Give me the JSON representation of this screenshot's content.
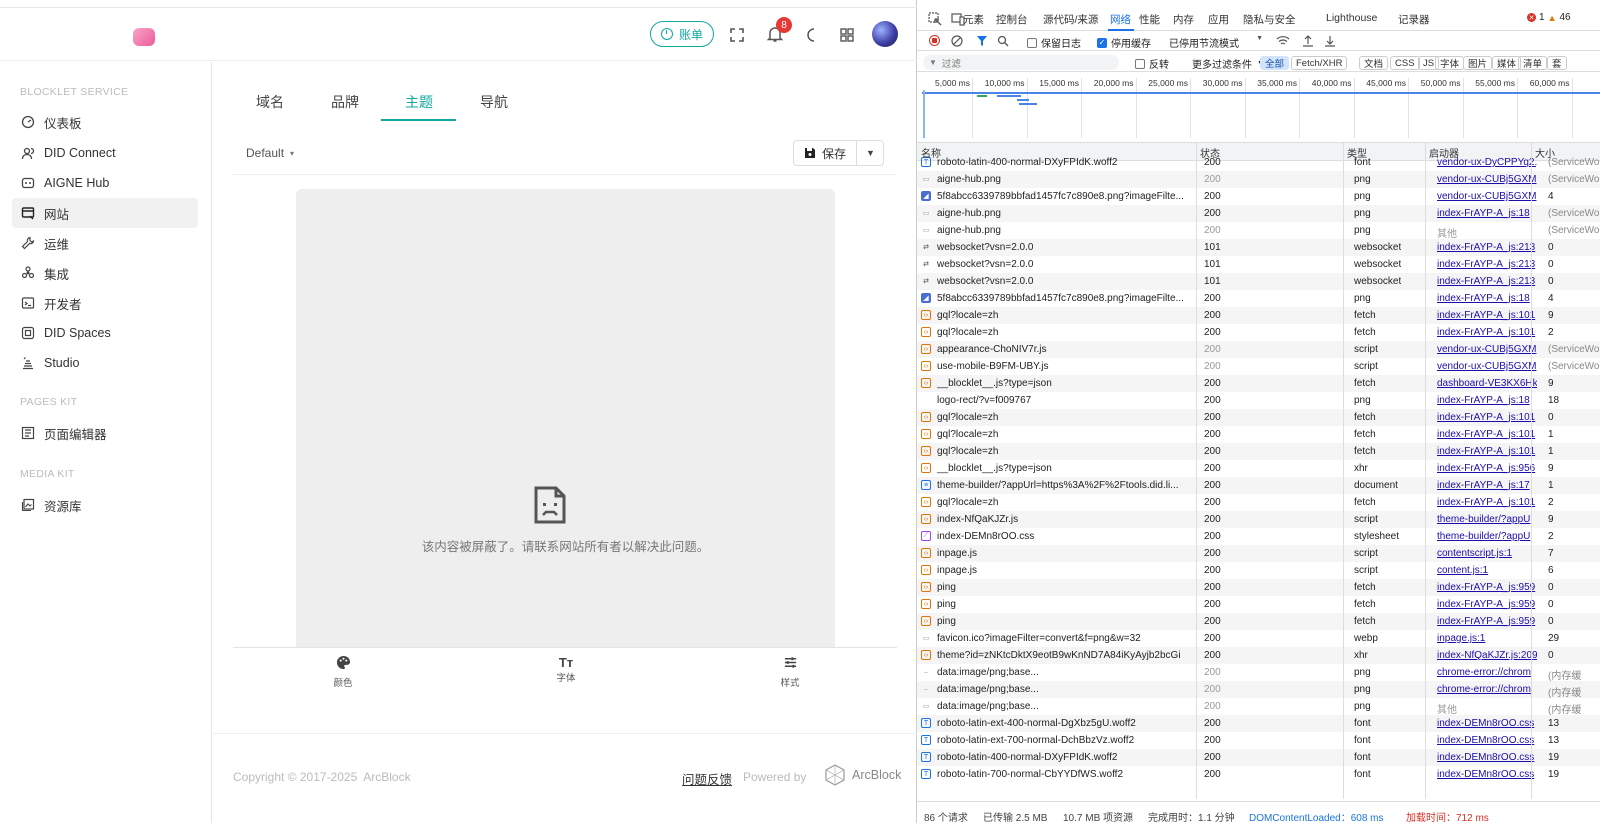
{
  "app": {
    "topbar": {
      "bill_label": "账单",
      "notification_count": "8"
    },
    "sidebar": {
      "sections": [
        {
          "title": "BLOCKLET SERVICE"
        },
        {
          "title": "PAGES KIT"
        },
        {
          "title": "MEDIA KIT"
        }
      ],
      "items": [
        {
          "label": "仪表板",
          "icon": "dashboard-icon"
        },
        {
          "label": "DID Connect",
          "icon": "users-icon"
        },
        {
          "label": "AIGNE Hub",
          "icon": "hub-icon"
        },
        {
          "label": "网站",
          "icon": "website-icon"
        },
        {
          "label": "运维",
          "icon": "wrench-icon"
        },
        {
          "label": "集成",
          "icon": "integration-icon"
        },
        {
          "label": "开发者",
          "icon": "terminal-icon"
        },
        {
          "label": "DID Spaces",
          "icon": "spaces-icon"
        },
        {
          "label": "Studio",
          "icon": "studio-icon"
        },
        {
          "label": "页面编辑器",
          "icon": "page-editor-icon"
        },
        {
          "label": "资源库",
          "icon": "media-library-icon"
        }
      ]
    },
    "tabs": [
      {
        "label": "域名"
      },
      {
        "label": "品牌"
      },
      {
        "label": "主题"
      },
      {
        "label": "导航"
      }
    ],
    "active_tab": "主题",
    "theme_select": "Default",
    "save_label": "保存",
    "blocked_message": "该内容被屏蔽了。请联系网站所有者以解决此问题。",
    "bottom_tools": [
      {
        "label": "颜色"
      },
      {
        "label": "字体"
      },
      {
        "label": "样式"
      }
    ],
    "footer": {
      "copyright": "Copyright © 2017-2025  ArcBlock",
      "feedback": "问题反馈",
      "powered_by": "Powered by",
      "brand": "ArcBlock"
    },
    "colors": {
      "accent": "#10a9a0",
      "badge": "#e53935"
    }
  },
  "devtools": {
    "tabs": [
      "元素",
      "控制台",
      "源代码/来源",
      "网络",
      "性能",
      "内存",
      "应用",
      "隐私与安全",
      "Lighthouse",
      "记录器"
    ],
    "active_tab": "网络",
    "errors": "1",
    "warnings": "46",
    "toolbar": {
      "preserve_log": "保留日志",
      "disable_cache": "停用缓存",
      "throttle": "已停用节流模式"
    },
    "filter": {
      "placeholder": "过滤",
      "invert": "反转",
      "more_filters": "更多过滤条件",
      "types": [
        "全部",
        "Fetch/XHR",
        "文档",
        "CSS",
        "JS",
        "字体",
        "图片",
        "媒体",
        "清单",
        "套"
      ]
    },
    "timeline_ticks": [
      "5,000 ms",
      "10,000 ms",
      "15,000 ms",
      "20,000 ms",
      "25,000 ms",
      "30,000 ms",
      "35,000 ms",
      "40,000 ms",
      "45,000 ms",
      "50,000 ms",
      "55,000 ms",
      "60,000 ms"
    ],
    "columns": [
      "名称",
      "状态",
      "类型",
      "启动器",
      "大小"
    ],
    "rows": [
      {
        "name": "roboto-latin-400-normal-DXyFPIdK.woff2",
        "status": "200",
        "type": "font",
        "initiator": "vendor-ux-DyCPPYq2.js",
        "size": "(ServiceWo",
        "kind": "font",
        "dim": false
      },
      {
        "name": "aigne-hub.png",
        "status": "200",
        "type": "png",
        "initiator": "vendor-ux-CUBj5GXM",
        "size": "(ServiceWo",
        "kind": "img",
        "dim": true
      },
      {
        "name": "5f8abcc6339789bbfad1457fc7c890e8.png?imageFilte...",
        "status": "200",
        "type": "png",
        "initiator": "vendor-ux-CUBj5GXM",
        "size": "4",
        "kind": "img2",
        "dim": false
      },
      {
        "name": "aigne-hub.png",
        "status": "200",
        "type": "png",
        "initiator": "index-FrAYP-A_js:18",
        "size": "(ServiceWo",
        "kind": "img",
        "dim": false
      },
      {
        "name": "aigne-hub.png",
        "status": "200",
        "type": "png",
        "initiator": "其他",
        "size": "(ServiceWo",
        "kind": "img",
        "dim": true,
        "plain": true
      },
      {
        "name": "websocket?vsn=2.0.0",
        "status": "101",
        "type": "websocket",
        "initiator": "index-FrAYP-A_js:213",
        "size": "0",
        "kind": "ws",
        "dim": false
      },
      {
        "name": "websocket?vsn=2.0.0",
        "status": "101",
        "type": "websocket",
        "initiator": "index-FrAYP-A_js:213",
        "size": "0",
        "kind": "ws",
        "dim": false
      },
      {
        "name": "websocket?vsn=2.0.0",
        "status": "101",
        "type": "websocket",
        "initiator": "index-FrAYP-A_js:213",
        "size": "0",
        "kind": "ws",
        "dim": false
      },
      {
        "name": "5f8abcc6339789bbfad1457fc7c890e8.png?imageFilte...",
        "status": "200",
        "type": "png",
        "initiator": "index-FrAYP-A_js:18",
        "size": "4",
        "kind": "img2",
        "dim": false
      },
      {
        "name": "gql?locale=zh",
        "status": "200",
        "type": "fetch",
        "initiator": "index-FrAYP-A_js:101",
        "size": "9",
        "kind": "fetch",
        "dim": false
      },
      {
        "name": "gql?locale=zh",
        "status": "200",
        "type": "fetch",
        "initiator": "index-FrAYP-A_js:101",
        "size": "2",
        "kind": "fetch",
        "dim": false
      },
      {
        "name": "appearance-ChoNIV7r.js",
        "status": "200",
        "type": "script",
        "initiator": "vendor-ux-CUBj5GXM",
        "size": "(ServiceWo",
        "kind": "script",
        "dim": true
      },
      {
        "name": "use-mobile-B9FM-UBY.js",
        "status": "200",
        "type": "script",
        "initiator": "vendor-ux-CUBj5GXM",
        "size": "(ServiceWo",
        "kind": "script",
        "dim": true
      },
      {
        "name": "__blocklet__.js?type=json",
        "status": "200",
        "type": "fetch",
        "initiator": "dashboard-VE3KX6Hk",
        "size": "9",
        "kind": "fetch",
        "dim": false
      },
      {
        "name": "logo-rect/?v=f009767",
        "status": "200",
        "type": "png",
        "initiator": "index-FrAYP-A_js:18",
        "size": "18",
        "kind": "none",
        "dim": false
      },
      {
        "name": "gql?locale=zh",
        "status": "200",
        "type": "fetch",
        "initiator": "index-FrAYP-A_js:101",
        "size": "0",
        "kind": "fetch",
        "dim": false
      },
      {
        "name": "gql?locale=zh",
        "status": "200",
        "type": "fetch",
        "initiator": "index-FrAYP-A_js:101",
        "size": "1",
        "kind": "fetch",
        "dim": false
      },
      {
        "name": "gql?locale=zh",
        "status": "200",
        "type": "fetch",
        "initiator": "index-FrAYP-A_js:101",
        "size": "1",
        "kind": "fetch",
        "dim": false
      },
      {
        "name": "__blocklet__.js?type=json",
        "status": "200",
        "type": "xhr",
        "initiator": "index-FrAYP-A_js:956",
        "size": "9",
        "kind": "fetch",
        "dim": false
      },
      {
        "name": "theme-builder/?appUrl=https%3A%2F%2Ftools.did.li...",
        "status": "200",
        "type": "document",
        "initiator": "index-FrAYP-A_js:17",
        "size": "1",
        "kind": "doc",
        "dim": false
      },
      {
        "name": "gql?locale=zh",
        "status": "200",
        "type": "fetch",
        "initiator": "index-FrAYP-A_js:101",
        "size": "2",
        "kind": "fetch",
        "dim": false
      },
      {
        "name": "index-NfQaKJZr.js",
        "status": "200",
        "type": "script",
        "initiator": "theme-builder/?appU",
        "size": "9",
        "kind": "script",
        "dim": false
      },
      {
        "name": "index-DEMn8rOO.css",
        "status": "200",
        "type": "stylesheet",
        "initiator": "theme-builder/?appU",
        "size": "2",
        "kind": "css",
        "dim": false
      },
      {
        "name": "inpage.js",
        "status": "200",
        "type": "script",
        "initiator": "contentscript.js:1",
        "size": "7",
        "kind": "script",
        "dim": false
      },
      {
        "name": "inpage.js",
        "status": "200",
        "type": "script",
        "initiator": "content.js:1",
        "size": "6",
        "kind": "script",
        "dim": false
      },
      {
        "name": "ping",
        "status": "200",
        "type": "fetch",
        "initiator": "index-FrAYP-A_js:959",
        "size": "0",
        "kind": "fetch",
        "dim": false
      },
      {
        "name": "ping",
        "status": "200",
        "type": "fetch",
        "initiator": "index-FrAYP-A_js:959",
        "size": "0",
        "kind": "fetch",
        "dim": false
      },
      {
        "name": "ping",
        "status": "200",
        "type": "fetch",
        "initiator": "index-FrAYP-A_js:959",
        "size": "0",
        "kind": "fetch",
        "dim": false
      },
      {
        "name": "favicon.ico?imageFilter=convert&f=png&w=32",
        "status": "200",
        "type": "webp",
        "initiator": "inpage.js:1",
        "size": "29",
        "kind": "img",
        "dim": false
      },
      {
        "name": "theme?id=zNKtcDktX9eotB9wKnND7A84iKyAyjb2bcGi",
        "status": "200",
        "type": "xhr",
        "initiator": "index-NfQaKJZr.js:209",
        "size": "0",
        "kind": "fetch",
        "dim": false
      },
      {
        "name": "data:image/png;base...",
        "status": "200",
        "type": "png",
        "initiator": "chrome-error://chrom",
        "size": "(内存缓",
        "kind": "dash",
        "dim": true
      },
      {
        "name": "data:image/png;base...",
        "status": "200",
        "type": "png",
        "initiator": "chrome-error://chrom",
        "size": "(内存缓",
        "kind": "dash",
        "dim": true
      },
      {
        "name": "data:image/png;base...",
        "status": "200",
        "type": "png",
        "initiator": "其他",
        "size": "(内存缓",
        "kind": "img",
        "dim": true,
        "plain": true
      },
      {
        "name": "roboto-latin-ext-400-normal-DgXbz5gU.woff2",
        "status": "200",
        "type": "font",
        "initiator": "index-DEMn8rOO.css",
        "size": "13",
        "kind": "font",
        "dim": false
      },
      {
        "name": "roboto-latin-ext-700-normal-DchBbzVz.woff2",
        "status": "200",
        "type": "font",
        "initiator": "index-DEMn8rOO.css",
        "size": "13",
        "kind": "font",
        "dim": false
      },
      {
        "name": "roboto-latin-400-normal-DXyFPIdK.woff2",
        "status": "200",
        "type": "font",
        "initiator": "index-DEMn8rOO.css",
        "size": "19",
        "kind": "font",
        "dim": false
      },
      {
        "name": "roboto-latin-700-normal-CbYYDfWS.woff2",
        "status": "200",
        "type": "font",
        "initiator": "index-DEMn8rOO.css",
        "size": "19",
        "kind": "font",
        "dim": false
      }
    ],
    "status_bar": {
      "requests": "86 个请求",
      "transferred": "已传输 2.5 MB",
      "resources": "10.7 MB 项资源",
      "finish": "完成用时：1.1 分钟",
      "dcl": "DOMContentLoaded：608 ms",
      "load": "加载时间：712 ms"
    }
  }
}
